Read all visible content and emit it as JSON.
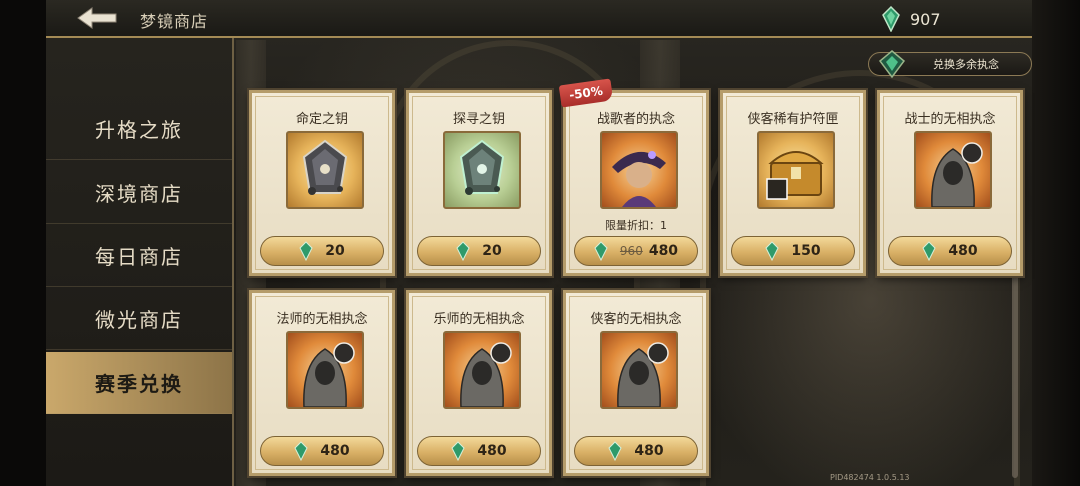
{
  "topbar": {
    "title": "梦镜商店",
    "currency_amount": "907"
  },
  "sidebar": {
    "items": [
      {
        "label": "升格之旅",
        "active": false
      },
      {
        "label": "深境商店",
        "active": false
      },
      {
        "label": "每日商店",
        "active": false
      },
      {
        "label": "微光商店",
        "active": false
      },
      {
        "label": "赛季兑换",
        "active": true
      }
    ]
  },
  "exchange_button": {
    "label": "兑换多余执念"
  },
  "cards": [
    {
      "title": "命定之钥",
      "price": "20",
      "icon": "key-stone-icon",
      "tone": "gold"
    },
    {
      "title": "探寻之钥",
      "price": "20",
      "icon": "key-stone-icon",
      "tone": "green"
    },
    {
      "title": "战歌者的执念",
      "price": "480",
      "old_price": "960",
      "discount": "-50%",
      "limit": "限量折扣：1",
      "icon": "portrait-icon",
      "tone": "orange"
    },
    {
      "title": "侠客稀有护符匣",
      "price": "150",
      "icon": "treasure-chest-icon",
      "tone": "gold"
    },
    {
      "title": "战士的无相执念",
      "price": "480",
      "icon": "hooded-figure-icon",
      "tone": "orange"
    },
    {
      "title": "法师的无相执念",
      "price": "480",
      "icon": "hooded-figure-icon",
      "tone": "orange"
    },
    {
      "title": "乐师的无相执念",
      "price": "480",
      "icon": "hooded-figure-icon",
      "tone": "orange"
    },
    {
      "title": "侠客的无相执念",
      "price": "480",
      "icon": "hooded-figure-icon",
      "tone": "orange"
    }
  ],
  "version": "PID482474 1.0.5.13",
  "colors": {
    "accent_gold": "#caa86b",
    "gem_green": "#2f9a6a",
    "discount_red": "#c3443c"
  }
}
